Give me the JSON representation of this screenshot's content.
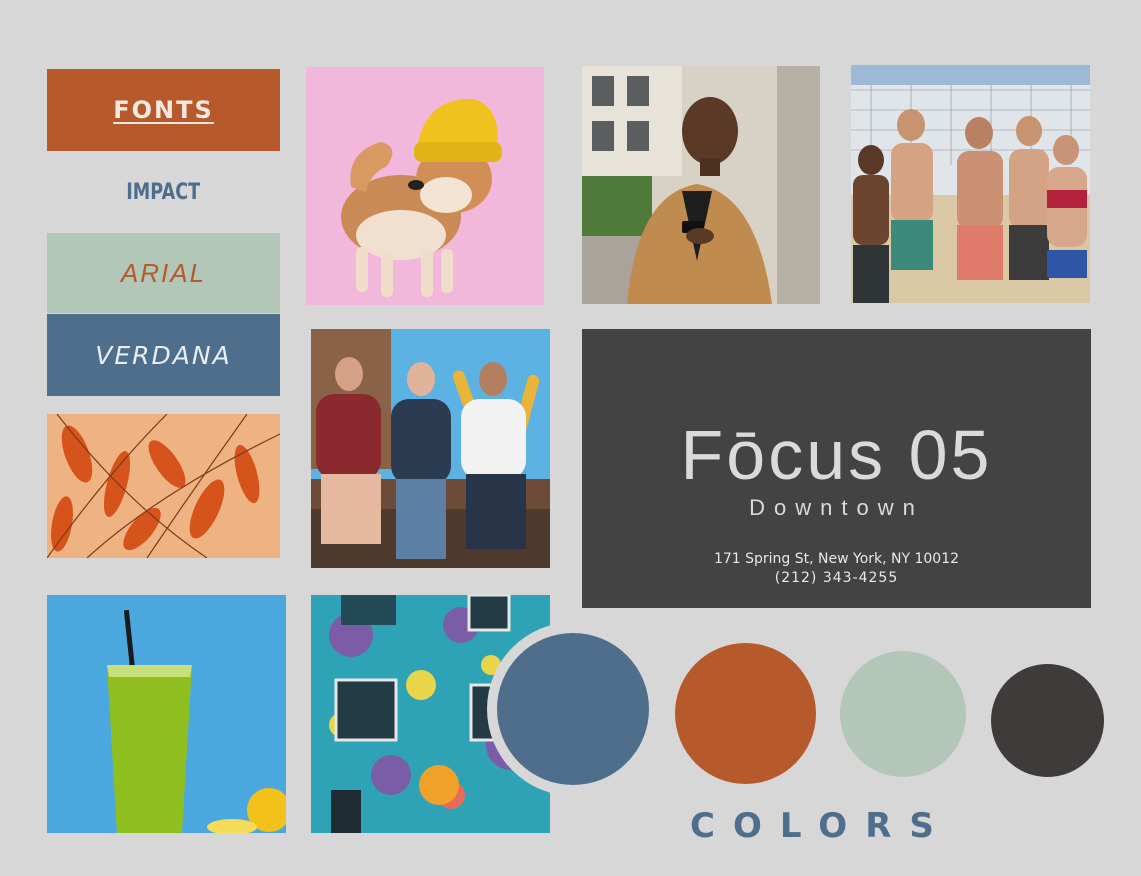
{
  "fonts": {
    "title": "FONTS",
    "impact": "IMPACT",
    "arial": "ARIAL",
    "verdana": "VERDANA"
  },
  "brand": {
    "name": "Fōcus 05",
    "subtitle": "Downtown",
    "address": "171 Spring St, New York, NY 10012",
    "phone": "(212) 343-4255"
  },
  "colors_label": "COLORS",
  "palette": [
    "#4f6e8c",
    "#b65a2c",
    "#b2c7b8",
    "#3f3b3b"
  ],
  "photos": [
    "shiba-dog-in-yellow-beanie",
    "man-in-camel-coat-with-phone",
    "friends-on-beach-volleyball",
    "orange-autumn-leaves",
    "three-friends-on-bench",
    "green-drink-in-cup",
    "colorful-mural-building"
  ]
}
